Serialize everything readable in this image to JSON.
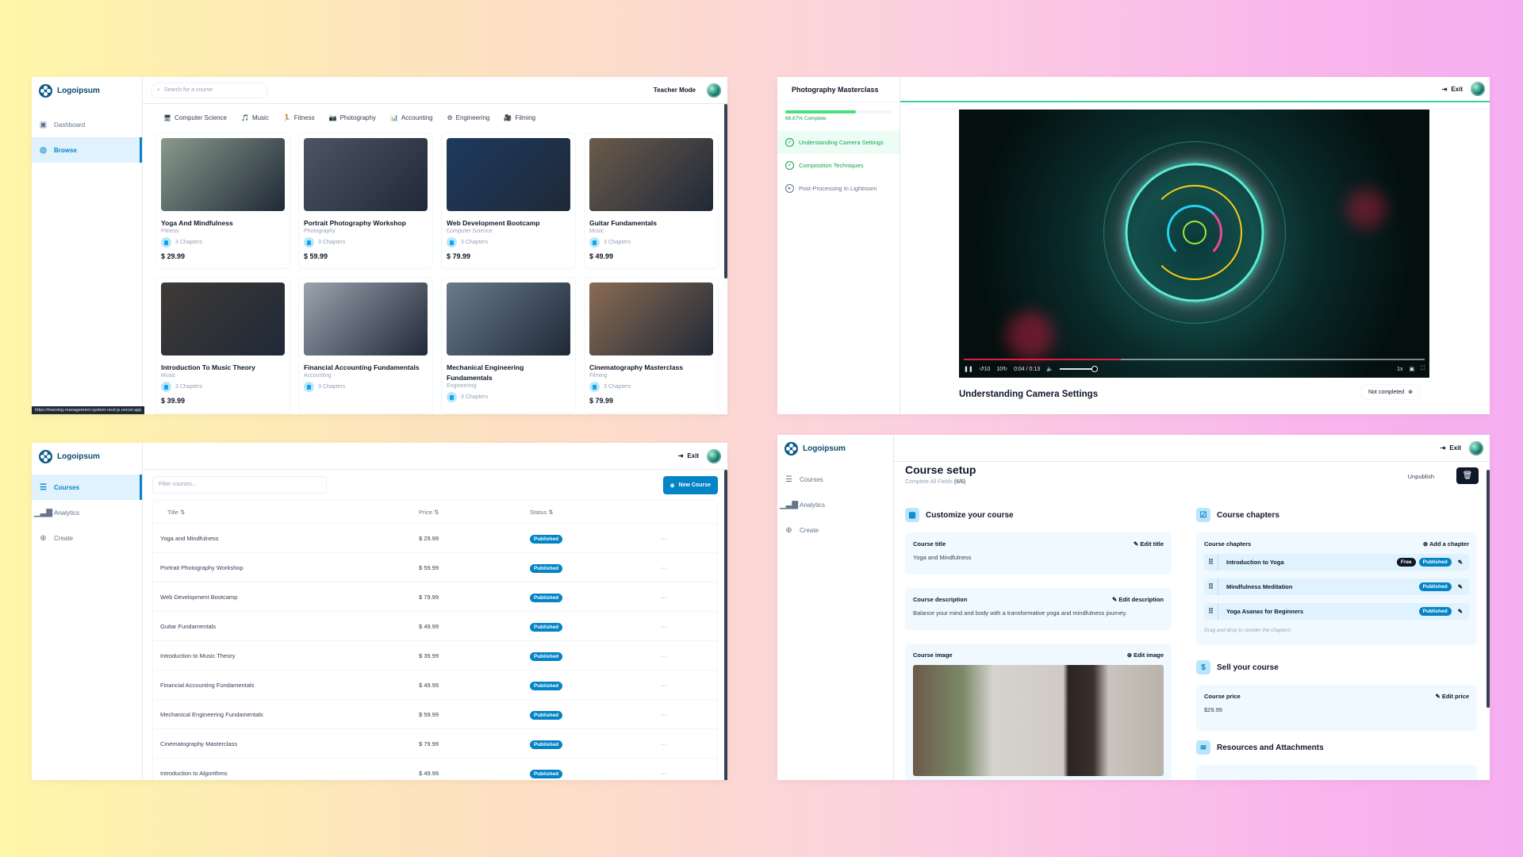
{
  "browse": {
    "logo": "Logoipsum",
    "sidebar": [
      {
        "label": "Dashboard",
        "icon": "layout-icon"
      },
      {
        "label": "Browse",
        "icon": "compass-icon",
        "active": true
      }
    ],
    "search_placeholder": "Search for a course",
    "teacher_mode": "Teacher Mode",
    "categories": [
      {
        "label": "Computer Science",
        "icon": "computer-icon",
        "glyph": "🖥"
      },
      {
        "label": "Music",
        "icon": "music-icon",
        "glyph": "🎵"
      },
      {
        "label": "Fitness",
        "icon": "runner-icon",
        "glyph": "🏃"
      },
      {
        "label": "Photography",
        "icon": "camera-icon",
        "glyph": "📷"
      },
      {
        "label": "Accounting",
        "icon": "chart-icon",
        "glyph": "📊"
      },
      {
        "label": "Engineering",
        "icon": "gear-icon",
        "glyph": "⚙"
      },
      {
        "label": "Filming",
        "icon": "film-icon",
        "glyph": "🎥"
      }
    ],
    "courses": [
      {
        "title": "Yoga And Mindfulness",
        "category": "Fitness",
        "chapters": "3 Chapters",
        "price": "$ 29.99",
        "thumb": "#8a9a8c"
      },
      {
        "title": "Portrait Photography Workshop",
        "category": "Photography",
        "chapters": "3 Chapters",
        "price": "$ 59.99",
        "thumb": "#4b5563"
      },
      {
        "title": "Web Development Bootcamp",
        "category": "Computer Science",
        "chapters": "3 Chapters",
        "price": "$ 79.99",
        "thumb": "#1e3a5f"
      },
      {
        "title": "Guitar Fundamentals",
        "category": "Music",
        "chapters": "3 Chapters",
        "price": "$ 49.99",
        "thumb": "#6b5b4b"
      },
      {
        "title": "Introduction To Music Theory",
        "category": "Music",
        "chapters": "3 Chapters",
        "price": "$ 39.99",
        "thumb": "#3f3a36"
      },
      {
        "title": "Financial Accounting Fundamentals",
        "category": "Accounting",
        "chapters": "3 Chapters",
        "price": "",
        "thumb": "#9ca3af"
      },
      {
        "title": "Mechanical Engineering Fundamentals",
        "category": "Engineering",
        "chapters": "3 Chapters",
        "price": "",
        "thumb": "#6b7b8c"
      },
      {
        "title": "Cinematography Masterclass",
        "category": "Filming",
        "chapters": "3 Chapters",
        "price": "$ 79.99",
        "thumb": "#8b6b52"
      }
    ],
    "status_url": "https://learning-management-system-next-js.vercel.app"
  },
  "player": {
    "course_title": "Photography Masterclass",
    "progress_percent": 66.67,
    "progress_label": "66.67% Complete",
    "chapters": [
      {
        "title": "Understanding Camera Settings",
        "state": "completed",
        "active": true
      },
      {
        "title": "Composition Techniques",
        "state": "completed"
      },
      {
        "title": "Post-Processing In Lightroom",
        "state": "not-started"
      }
    ],
    "exit_label": "Exit",
    "video": {
      "time": "0:04 / 0:13",
      "played_fraction": 0.34,
      "volume_fraction": 1.0,
      "rewind": "10",
      "forward": "10",
      "speed": "1x"
    },
    "lesson_title": "Understanding Camera Settings",
    "status_button": "Not completed"
  },
  "courses_admin": {
    "logo": "Logoipsum",
    "sidebar": [
      {
        "label": "Courses",
        "icon": "list-icon",
        "active": true
      },
      {
        "label": "Analytics",
        "icon": "bar-chart-icon"
      },
      {
        "label": "Create",
        "icon": "plus-circle-icon"
      }
    ],
    "exit_label": "Exit",
    "filter_placeholder": "Filter courses...",
    "new_course_label": "New Course",
    "columns": [
      "Title",
      "Price",
      "Status"
    ],
    "rows": [
      {
        "title": "Yoga and Mindfulness",
        "price": "$ 29.99",
        "status": "Published"
      },
      {
        "title": "Portrait Photography Workshop",
        "price": "$ 59.99",
        "status": "Published"
      },
      {
        "title": "Web Development Bootcamp",
        "price": "$ 79.99",
        "status": "Published"
      },
      {
        "title": "Guitar Fundamentals",
        "price": "$ 49.99",
        "status": "Published"
      },
      {
        "title": "Introduction to Music Theory",
        "price": "$ 39.99",
        "status": "Published"
      },
      {
        "title": "Financial Accounting Fundamentals",
        "price": "$ 49.99",
        "status": "Published"
      },
      {
        "title": "Mechanical Engineering Fundamentals",
        "price": "$ 59.99",
        "status": "Published"
      },
      {
        "title": "Cinematography Masterclass",
        "price": "$ 79.99",
        "status": "Published"
      },
      {
        "title": "Introduction to Algorithms",
        "price": "$ 49.99",
        "status": "Published"
      }
    ]
  },
  "setup": {
    "logo": "Logoipsum",
    "sidebar": [
      {
        "label": "Courses",
        "icon": "list-icon"
      },
      {
        "label": "Analytics",
        "icon": "bar-chart-icon"
      },
      {
        "label": "Create",
        "icon": "plus-circle-icon"
      }
    ],
    "exit_label": "Exit",
    "title": "Course setup",
    "subtitle": "Complete All Fields",
    "subtitle_count": "(6/6)",
    "unpublish_label": "Unpublish",
    "customize_heading": "Customize your course",
    "course_title_label": "Course title",
    "course_title_action": "Edit title",
    "course_title_value": "Yoga and Mindfulness",
    "course_desc_label": "Course description",
    "course_desc_action": "Edit description",
    "course_desc_value": "Balance your mind and body with a transformative yoga and mindfulness journey.",
    "course_image_label": "Course image",
    "course_image_action": "Edit image",
    "chapters_heading": "Course chapters",
    "chapters_label": "Course chapters",
    "add_chapter": "Add a chapter",
    "chapters": [
      {
        "title": "Introduction to Yoga",
        "free": "Free",
        "status": "Published"
      },
      {
        "title": "Mindfulness Meditation",
        "free": "",
        "status": "Published"
      },
      {
        "title": "Yoga Asanas for Beginners",
        "free": "",
        "status": "Published"
      }
    ],
    "drag_hint": "Drag and drop to reorder the chapters",
    "sell_heading": "Sell your course",
    "price_label": "Course price",
    "price_action": "Edit price",
    "price_value": "$29.99",
    "resources_heading": "Resources and Attachments"
  }
}
